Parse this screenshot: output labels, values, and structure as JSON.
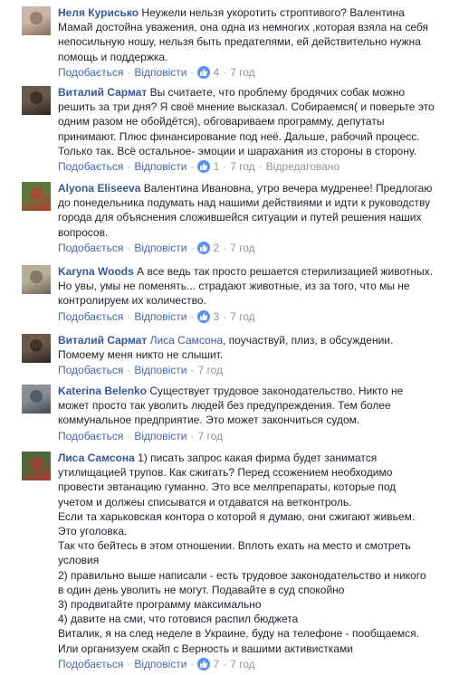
{
  "ui": {
    "like_label": "Подобається",
    "reply_label": "Відповісти",
    "separator": "·"
  },
  "comments": [
    {
      "author": "Неля Курисько",
      "text": "Неужели нельзя укоротить строптивого? Валентина\nМамай достойна уважения, она одна из немногих ,которая взяла на себя\nнепосильную ношу, нельзя быть предателями, ей действительно нужна\nпомощь и поддержка.",
      "likes": "4",
      "time": "7 год",
      "avatar_bg": "#c9b8a8",
      "avatar_fg": "#8a6a55"
    },
    {
      "author": "Виталий Сармат",
      "text": "Вы считаете, что проблему бродячих собак можно\nрешить за три дня? Я своё мнение высказал. Собираемся( и поверьте это\nодним разом не обойдётся), обговариваем программу, депутаты\nпринимают. Плюс финансирование под неё. Дальше, рабочий процесс.\nТолько так. Всё остальное- эмоции и шарахания из стороны в сторону.",
      "likes": "1",
      "time": "7 год",
      "edited": "Відредаговано",
      "avatar_bg": "#6b5a4a",
      "avatar_fg": "#2b2420"
    },
    {
      "author": "Alyona Eliseeva",
      "text": "Валентина Ивановна, утро вечера мудренее! Предлогаю\nдо понедельника подумать над нашими действиями и идти к руководству\nгорода для объяснения сложившейся ситуации и путей решения наших\nвопросов.",
      "likes": "2",
      "time": "7 год",
      "avatar_bg": "#5d7a3c",
      "avatar_fg": "#c0392b"
    },
    {
      "author": "Karyna Woods",
      "text": "А все ведь так просто решается стерилизацией животных.\nНо увы, умы не поменять... страдают животные, из за того, что мы не\nконтролируем их количество.",
      "likes": "3",
      "time": "7 год",
      "avatar_bg": "#b8b09a",
      "avatar_fg": "#6d6552"
    },
    {
      "author": "Виталий Сармат",
      "mention": "Лиса Самсона",
      "text": ", поучаствуй, плиз, в обсуждении.\nПомоему меня никто не слышит.",
      "time": "7 год",
      "avatar_bg": "#6b5a4a",
      "avatar_fg": "#2b2420"
    },
    {
      "author": "Katerina Belenko",
      "text": "Существует трудовое законодательство. Никто не\nможет просто так уволить людей без предупреждения. Тем более\nкоммунальное предприятие. Это может закончиться судом.",
      "time": "7 год",
      "avatar_bg": "#8a8f96",
      "avatar_fg": "#3e4a57"
    },
    {
      "author": "Лиса Самсона",
      "text": "1) писать запрос какая фирма будет заниматся\nутилищацией трупов. Как сжигать? Перед ссожением необходимо\nпровести эвтанацию гуманно. Это все мелпрепараты, которые под\nучетом и должеы списыватся и отдаватся на ветконтроль.\nЕсли та харьковская контора о которой я думаю, они сжигают живьем.\nЭто уголовка.\nТак что бейтесь в этом отношении. Вплоть ехать на место и смотреть\nусловия\n2) правильно выше написали - есть трудовое законодательство и никого\nв один день уволить не могут. Подавайте в суд спокойно\n3) продвигайте программу максимально\n4) давите на сми, что готовися распил бюджета\nВиталик, я на след неделе в Украине, буду на телефоне - пообщаемся.\nИли организуем скайп с Верность и вашими активистками",
      "likes": "7",
      "time": "7 год",
      "avatar_bg": "#4f6b3a",
      "avatar_fg": "#b83232"
    }
  ]
}
